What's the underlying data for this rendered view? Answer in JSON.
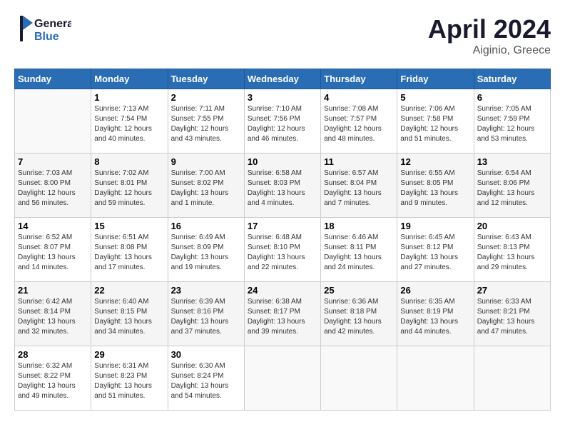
{
  "header": {
    "logo_line1": "General",
    "logo_line2": "Blue",
    "month": "April 2024",
    "location": "Aiginio, Greece"
  },
  "days_of_week": [
    "Sunday",
    "Monday",
    "Tuesday",
    "Wednesday",
    "Thursday",
    "Friday",
    "Saturday"
  ],
  "weeks": [
    [
      {
        "day": "",
        "info": ""
      },
      {
        "day": "1",
        "info": "Sunrise: 7:13 AM\nSunset: 7:54 PM\nDaylight: 12 hours\nand 40 minutes."
      },
      {
        "day": "2",
        "info": "Sunrise: 7:11 AM\nSunset: 7:55 PM\nDaylight: 12 hours\nand 43 minutes."
      },
      {
        "day": "3",
        "info": "Sunrise: 7:10 AM\nSunset: 7:56 PM\nDaylight: 12 hours\nand 46 minutes."
      },
      {
        "day": "4",
        "info": "Sunrise: 7:08 AM\nSunset: 7:57 PM\nDaylight: 12 hours\nand 48 minutes."
      },
      {
        "day": "5",
        "info": "Sunrise: 7:06 AM\nSunset: 7:58 PM\nDaylight: 12 hours\nand 51 minutes."
      },
      {
        "day": "6",
        "info": "Sunrise: 7:05 AM\nSunset: 7:59 PM\nDaylight: 12 hours\nand 53 minutes."
      }
    ],
    [
      {
        "day": "7",
        "info": "Sunrise: 7:03 AM\nSunset: 8:00 PM\nDaylight: 12 hours\nand 56 minutes."
      },
      {
        "day": "8",
        "info": "Sunrise: 7:02 AM\nSunset: 8:01 PM\nDaylight: 12 hours\nand 59 minutes."
      },
      {
        "day": "9",
        "info": "Sunrise: 7:00 AM\nSunset: 8:02 PM\nDaylight: 13 hours\nand 1 minute."
      },
      {
        "day": "10",
        "info": "Sunrise: 6:58 AM\nSunset: 8:03 PM\nDaylight: 13 hours\nand 4 minutes."
      },
      {
        "day": "11",
        "info": "Sunrise: 6:57 AM\nSunset: 8:04 PM\nDaylight: 13 hours\nand 7 minutes."
      },
      {
        "day": "12",
        "info": "Sunrise: 6:55 AM\nSunset: 8:05 PM\nDaylight: 13 hours\nand 9 minutes."
      },
      {
        "day": "13",
        "info": "Sunrise: 6:54 AM\nSunset: 8:06 PM\nDaylight: 13 hours\nand 12 minutes."
      }
    ],
    [
      {
        "day": "14",
        "info": "Sunrise: 6:52 AM\nSunset: 8:07 PM\nDaylight: 13 hours\nand 14 minutes."
      },
      {
        "day": "15",
        "info": "Sunrise: 6:51 AM\nSunset: 8:08 PM\nDaylight: 13 hours\nand 17 minutes."
      },
      {
        "day": "16",
        "info": "Sunrise: 6:49 AM\nSunset: 8:09 PM\nDaylight: 13 hours\nand 19 minutes."
      },
      {
        "day": "17",
        "info": "Sunrise: 6:48 AM\nSunset: 8:10 PM\nDaylight: 13 hours\nand 22 minutes."
      },
      {
        "day": "18",
        "info": "Sunrise: 6:46 AM\nSunset: 8:11 PM\nDaylight: 13 hours\nand 24 minutes."
      },
      {
        "day": "19",
        "info": "Sunrise: 6:45 AM\nSunset: 8:12 PM\nDaylight: 13 hours\nand 27 minutes."
      },
      {
        "day": "20",
        "info": "Sunrise: 6:43 AM\nSunset: 8:13 PM\nDaylight: 13 hours\nand 29 minutes."
      }
    ],
    [
      {
        "day": "21",
        "info": "Sunrise: 6:42 AM\nSunset: 8:14 PM\nDaylight: 13 hours\nand 32 minutes."
      },
      {
        "day": "22",
        "info": "Sunrise: 6:40 AM\nSunset: 8:15 PM\nDaylight: 13 hours\nand 34 minutes."
      },
      {
        "day": "23",
        "info": "Sunrise: 6:39 AM\nSunset: 8:16 PM\nDaylight: 13 hours\nand 37 minutes."
      },
      {
        "day": "24",
        "info": "Sunrise: 6:38 AM\nSunset: 8:17 PM\nDaylight: 13 hours\nand 39 minutes."
      },
      {
        "day": "25",
        "info": "Sunrise: 6:36 AM\nSunset: 8:18 PM\nDaylight: 13 hours\nand 42 minutes."
      },
      {
        "day": "26",
        "info": "Sunrise: 6:35 AM\nSunset: 8:19 PM\nDaylight: 13 hours\nand 44 minutes."
      },
      {
        "day": "27",
        "info": "Sunrise: 6:33 AM\nSunset: 8:21 PM\nDaylight: 13 hours\nand 47 minutes."
      }
    ],
    [
      {
        "day": "28",
        "info": "Sunrise: 6:32 AM\nSunset: 8:22 PM\nDaylight: 13 hours\nand 49 minutes."
      },
      {
        "day": "29",
        "info": "Sunrise: 6:31 AM\nSunset: 8:23 PM\nDaylight: 13 hours\nand 51 minutes."
      },
      {
        "day": "30",
        "info": "Sunrise: 6:30 AM\nSunset: 8:24 PM\nDaylight: 13 hours\nand 54 minutes."
      },
      {
        "day": "",
        "info": ""
      },
      {
        "day": "",
        "info": ""
      },
      {
        "day": "",
        "info": ""
      },
      {
        "day": "",
        "info": ""
      }
    ]
  ]
}
